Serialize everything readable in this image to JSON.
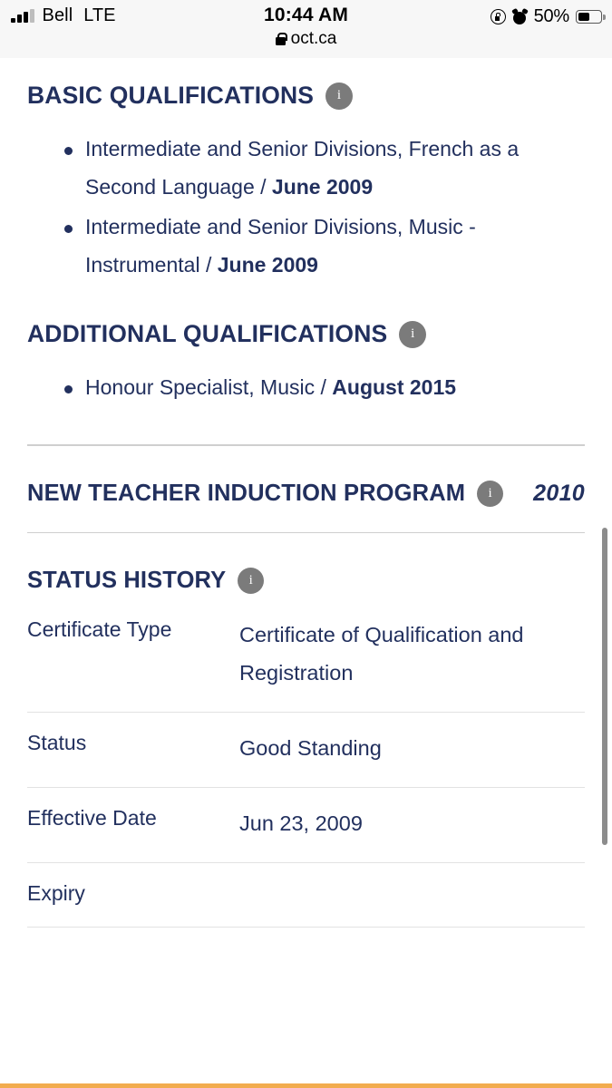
{
  "status_bar": {
    "carrier": "Bell",
    "network": "LTE",
    "time": "10:44 AM",
    "url": "oct.ca",
    "battery_percent": "50%",
    "battery_level": 50,
    "signal_bars_filled": 3,
    "icons": {
      "signal": "signal-bars-icon",
      "lock": "lock-icon",
      "rotation_lock": "rotation-lock-icon",
      "alarm": "alarm-clock-icon",
      "battery": "battery-icon"
    }
  },
  "sections": {
    "basic_qualifications": {
      "title": "BASIC QUALIFICATIONS",
      "info_label": "i",
      "items": [
        {
          "name": "Intermediate and Senior Divisions, French as a Second Language",
          "separator": " / ",
          "date": "June 2009"
        },
        {
          "name": "Intermediate and Senior Divisions, Music - Instrumental",
          "separator": " / ",
          "date": "June 2009"
        }
      ]
    },
    "additional_qualifications": {
      "title": "ADDITIONAL QUALIFICATIONS",
      "info_label": "i",
      "items": [
        {
          "name": "Honour Specialist, Music",
          "separator": " / ",
          "date": "August 2015"
        }
      ]
    },
    "new_teacher_induction_program": {
      "title": "NEW TEACHER INDUCTION PROGRAM",
      "info_label": "i",
      "year": "2010"
    },
    "status_history": {
      "title": "STATUS HISTORY",
      "info_label": "i",
      "rows": [
        {
          "label": "Certificate Type",
          "value": "Certificate of Qualification and Registration"
        },
        {
          "label": "Status",
          "value": "Good Standing"
        },
        {
          "label": "Effective Date",
          "value": "Jun 23, 2009"
        },
        {
          "label": "Expiry",
          "value": ""
        }
      ]
    }
  },
  "colors": {
    "heading_navy": "#22305e",
    "info_badge_grey": "#7b7b7b",
    "bottom_bar_orange": "#f2ac4e",
    "divider_grey": "#cfcfcf",
    "scrollbar_grey": "#8c8c8c"
  }
}
